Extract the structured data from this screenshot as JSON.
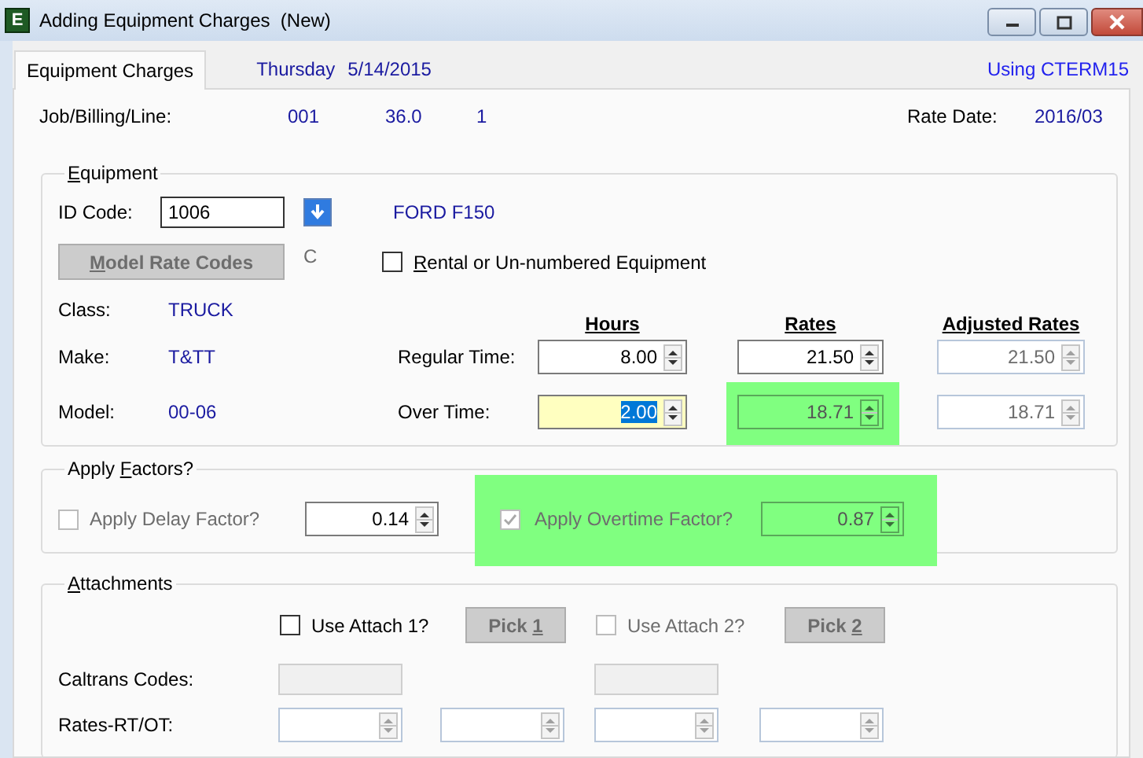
{
  "window": {
    "title": "Adding Equipment Charges  (New)",
    "icon_letter": "E"
  },
  "tabs": [
    {
      "label": "Equipment Charges",
      "selected": true
    }
  ],
  "header": {
    "day": "Thursday",
    "date": "5/14/2015",
    "term": "Using CTERM15"
  },
  "job": {
    "label": "Job/Billing/Line:",
    "values": [
      "001",
      "36.0",
      "1"
    ],
    "rate_date_label": "Rate Date:",
    "rate_date": "2016/03"
  },
  "equipment": {
    "title": "Equipment",
    "id_label": "ID Code:",
    "id_value": "1006",
    "description": "FORD F150",
    "model_rate_button": {
      "label": "Model Rate Codes",
      "disabled": true
    },
    "code_letter": "C",
    "rental": {
      "label": "Rental or Un-numbered Equipment",
      "checked": false,
      "disabled": false
    },
    "info": [
      {
        "label": "Class:",
        "value": "TRUCK"
      },
      {
        "label": "Make:",
        "value": "T&TT"
      },
      {
        "label": "Model:",
        "value": "00-06"
      }
    ],
    "columns": [
      "Hours",
      "Rates",
      "Adjusted Rates"
    ],
    "rows": [
      {
        "label": "Regular Time:",
        "cells": [
          {
            "value": "8.00",
            "disabled": false,
            "focused": false,
            "highlighted": false
          },
          {
            "value": "21.50",
            "disabled": false,
            "focused": false,
            "highlighted": false
          },
          {
            "value": "21.50",
            "disabled": true,
            "focused": false,
            "highlighted": false
          }
        ]
      },
      {
        "label": "Over Time:",
        "cells": [
          {
            "value": "2.00",
            "disabled": false,
            "focused": true,
            "highlighted": false
          },
          {
            "value": "18.71",
            "disabled": false,
            "focused": false,
            "highlighted": true
          },
          {
            "value": "18.71",
            "disabled": true,
            "focused": false,
            "highlighted": false
          }
        ]
      }
    ]
  },
  "factors": {
    "title": "Apply Factors?",
    "items": [
      {
        "label": "Apply Delay Factor?",
        "checked": false,
        "disabled": true,
        "value": "0.14",
        "highlighted": false
      },
      {
        "label": "Apply Overtime Factor?",
        "checked": true,
        "disabled": true,
        "value": "0.87",
        "highlighted": true
      }
    ]
  },
  "attachments": {
    "title": "Attachments",
    "items": [
      {
        "label": "Use Attach 1?",
        "checked": false,
        "disabled": false,
        "button": {
          "label": "Pick 1",
          "disabled": true
        }
      },
      {
        "label": "Use Attach 2?",
        "checked": false,
        "disabled": true,
        "button": {
          "label": "Pick 2",
          "disabled": true
        }
      }
    ],
    "codes_label": "Caltrans Codes:",
    "rates_label": "Rates-RT/OT:"
  }
}
